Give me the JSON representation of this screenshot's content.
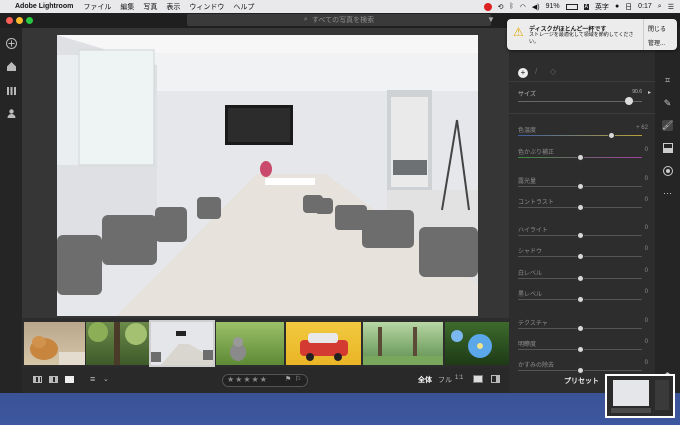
{
  "menubar": {
    "app_name": "Adobe Lightroom",
    "menus": [
      "ファイル",
      "編集",
      "写真",
      "表示",
      "ウィンドウ",
      "ヘルプ"
    ],
    "battery": "91%",
    "input_method": "英字",
    "day": "日",
    "time": "0:17"
  },
  "search": {
    "placeholder": "すべての写真を検索"
  },
  "notification": {
    "title": "ディスクがほとんど一杯です",
    "body": "ストレージを最適化して領域を節約してください。",
    "close_label": "閉じる",
    "manage_label": "管理..."
  },
  "panel": {
    "size_label": "サイズ",
    "size_value": "90.6",
    "sliders": [
      {
        "label": "色温度",
        "value": "+ 62",
        "level": 0.75
      },
      {
        "label": "色かぶり補正",
        "value": "0",
        "level": 0.5
      },
      {
        "label": "露光量",
        "value": "0",
        "level": 0.5
      },
      {
        "label": "コントラスト",
        "value": "0",
        "level": 0.5
      },
      {
        "label": "ハイライト",
        "value": "0",
        "level": 0.5
      },
      {
        "label": "シャドウ",
        "value": "0",
        "level": 0.5
      },
      {
        "label": "白レベル",
        "value": "0",
        "level": 0.5
      },
      {
        "label": "黒レベル",
        "value": "0",
        "level": 0.5
      },
      {
        "label": "テクスチャ",
        "value": "0",
        "level": 0.5
      },
      {
        "label": "明瞭度",
        "value": "0",
        "level": 0.5
      },
      {
        "label": "かすみの除去",
        "value": "0",
        "level": 0.5
      }
    ],
    "preset_label": "プリセット"
  },
  "bottombar": {
    "rating": "★★★★★",
    "fit_all": "全体",
    "fit_full": "フル",
    "fit_one": "1:1"
  },
  "colors": {
    "window_bg": "#2b2b2b",
    "panel_bg": "#2d2d2d",
    "accent_red_car": "#d33a32"
  },
  "icons": {
    "left": [
      "add-icon",
      "home-icon",
      "library-icon",
      "people-icon"
    ],
    "right": [
      "edit-sliders-icon",
      "crop-icon",
      "healing-icon",
      "brush-icon",
      "gradient-icon",
      "radial-icon",
      "more-icon",
      "tag-icon"
    ]
  }
}
